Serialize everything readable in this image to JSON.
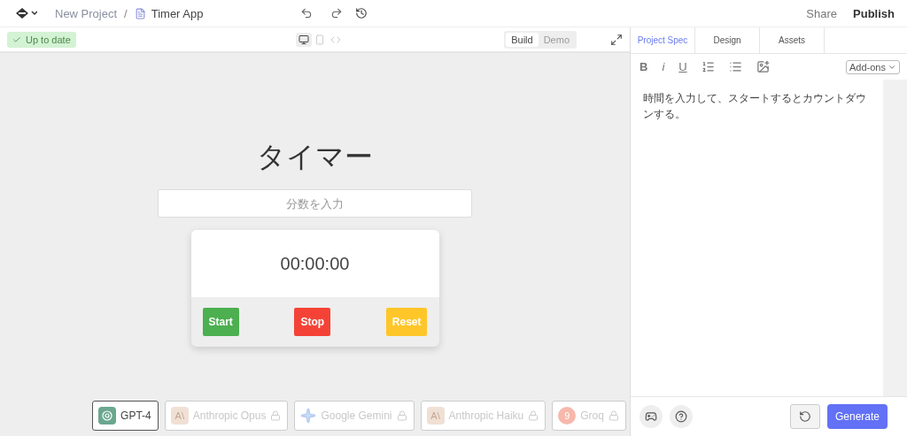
{
  "header": {
    "breadcrumb": [
      "New Project",
      "Timer App"
    ],
    "separator": "/",
    "share": "Share",
    "publish": "Publish"
  },
  "status": {
    "label": "Up to date",
    "ok": true
  },
  "devices": [
    {
      "kind": "desktop",
      "selected": true
    },
    {
      "kind": "mobile",
      "selected": false
    },
    {
      "kind": "code",
      "selected": false
    }
  ],
  "modes": [
    {
      "label": "Build",
      "selected": true
    },
    {
      "label": "Demo",
      "selected": false
    }
  ],
  "preview": {
    "title": "タイマー",
    "placeholder": "分数を入力",
    "time": "00:00:00",
    "buttons": [
      {
        "label": "Start",
        "color": "#4caf50"
      },
      {
        "label": "Stop",
        "color": "#f44336"
      },
      {
        "label": "Reset",
        "color": "#ffc629"
      }
    ]
  },
  "models": [
    {
      "label": "GPT-4",
      "kind": "openai",
      "selected": true,
      "locked": false
    },
    {
      "label": "Anthropic Opus",
      "kind": "anthropic",
      "logo_text": "A\\",
      "selected": false,
      "locked": true
    },
    {
      "label": "Google Gemini",
      "kind": "gemini",
      "selected": false,
      "locked": true
    },
    {
      "label": "Anthropic Haiku",
      "kind": "anthropic",
      "logo_text": "A\\",
      "selected": false,
      "locked": true
    },
    {
      "label": "Groq",
      "kind": "groq",
      "logo_text": "9",
      "selected": false,
      "locked": true
    }
  ],
  "panel": {
    "tabs": [
      {
        "label": "Project Spec",
        "selected": true
      },
      {
        "label": "Design",
        "selected": false
      },
      {
        "label": "Assets",
        "selected": false
      }
    ],
    "format": [
      {
        "kind": "bold",
        "text": "B"
      },
      {
        "kind": "italic",
        "text": "i"
      },
      {
        "kind": "underline",
        "text": "U"
      },
      {
        "kind": "ordered"
      },
      {
        "kind": "bullet"
      },
      {
        "kind": "image"
      }
    ],
    "addons": "Add-ons",
    "spec": "時間を入力して、スタートするとカウントダウンする。",
    "generate": "Generate"
  }
}
